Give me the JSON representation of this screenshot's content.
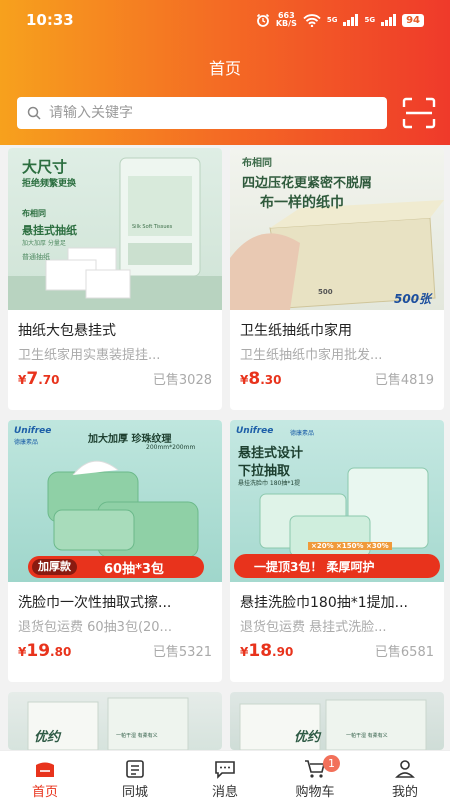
{
  "status_bar": {
    "time": "10:33",
    "net_speed_value": "663",
    "net_speed_unit": "KB/S",
    "signal1": "5G",
    "signal2": "5G",
    "battery": "94"
  },
  "header": {
    "title": "首页"
  },
  "search": {
    "placeholder": "请输入关键字"
  },
  "colors": {
    "accent": "#e8331c",
    "header_start": "#f7a11d",
    "header_end": "#ef3a2a"
  },
  "products": [
    {
      "title": "抽纸大包悬挂式",
      "desc": "卫生纸家用实惠装提挂...",
      "price_symbol": "¥",
      "price_int": "7",
      "price_dec": ".70",
      "sold": "已售3028",
      "image_text": {
        "headline": "大尺寸",
        "sub": "拒绝频繁更换",
        "brand": "布相同",
        "name": "悬挂式抽纸",
        "tags": "加大加厚   分量足",
        "small": "普通抽纸",
        "pack": "Silk Soft Tissues"
      }
    },
    {
      "title": "卫生纸抽纸巾家用",
      "desc": "卫生纸抽纸巾家用批发...",
      "price_symbol": "¥",
      "price_int": "8",
      "price_dec": ".30",
      "sold": "已售4819",
      "image_text": {
        "brand": "布相同",
        "line1": "四边压花更紧密不脱屑",
        "line2": "布一样的纸巾",
        "count": "500张",
        "pack_num": "500"
      }
    },
    {
      "title": "洗脸巾一次性抽取式擦...",
      "desc": "退货包运费 60抽3包(20...",
      "price_symbol": "¥",
      "price_int": "19",
      "price_dec": ".80",
      "sold": "已售5321",
      "image_text": {
        "brand": "Unifree",
        "brand_cn": "德康素品",
        "headline": "加大加厚  珍珠纹理",
        "size": "200mm*200mm",
        "tag": "加厚款",
        "banner": "60抽*3包"
      }
    },
    {
      "title": "悬挂洗脸巾180抽*1提加...",
      "desc": "退货包运费 悬挂式洗脸...",
      "price_symbol": "¥",
      "price_int": "18",
      "price_dec": ".90",
      "sold": "已售6581",
      "image_text": {
        "brand": "Unifree",
        "brand_cn": "德康素品",
        "line1": "悬挂式设计",
        "line2": "下拉抽取",
        "pack": "悬挂洗脸巾 180抽*1提",
        "sizes": "×20%  ×150%  ×30%",
        "banner": "一提顶3包！ 柔厚呵护"
      }
    },
    {
      "image_text": {
        "brand": "优约",
        "tagline": "一帕干湿 有柔有义"
      }
    },
    {
      "image_text": {
        "brand": "优约",
        "tagline": "一帕干湿 有柔有义"
      }
    }
  ],
  "tabbar": {
    "items": [
      {
        "label": "首页",
        "icon": "home-icon",
        "active": true
      },
      {
        "label": "同城",
        "icon": "book-icon",
        "active": false
      },
      {
        "label": "消息",
        "icon": "message-icon",
        "active": false
      },
      {
        "label": "购物车",
        "icon": "cart-icon",
        "active": false,
        "badge": "1"
      },
      {
        "label": "我的",
        "icon": "user-icon",
        "active": false
      }
    ]
  }
}
